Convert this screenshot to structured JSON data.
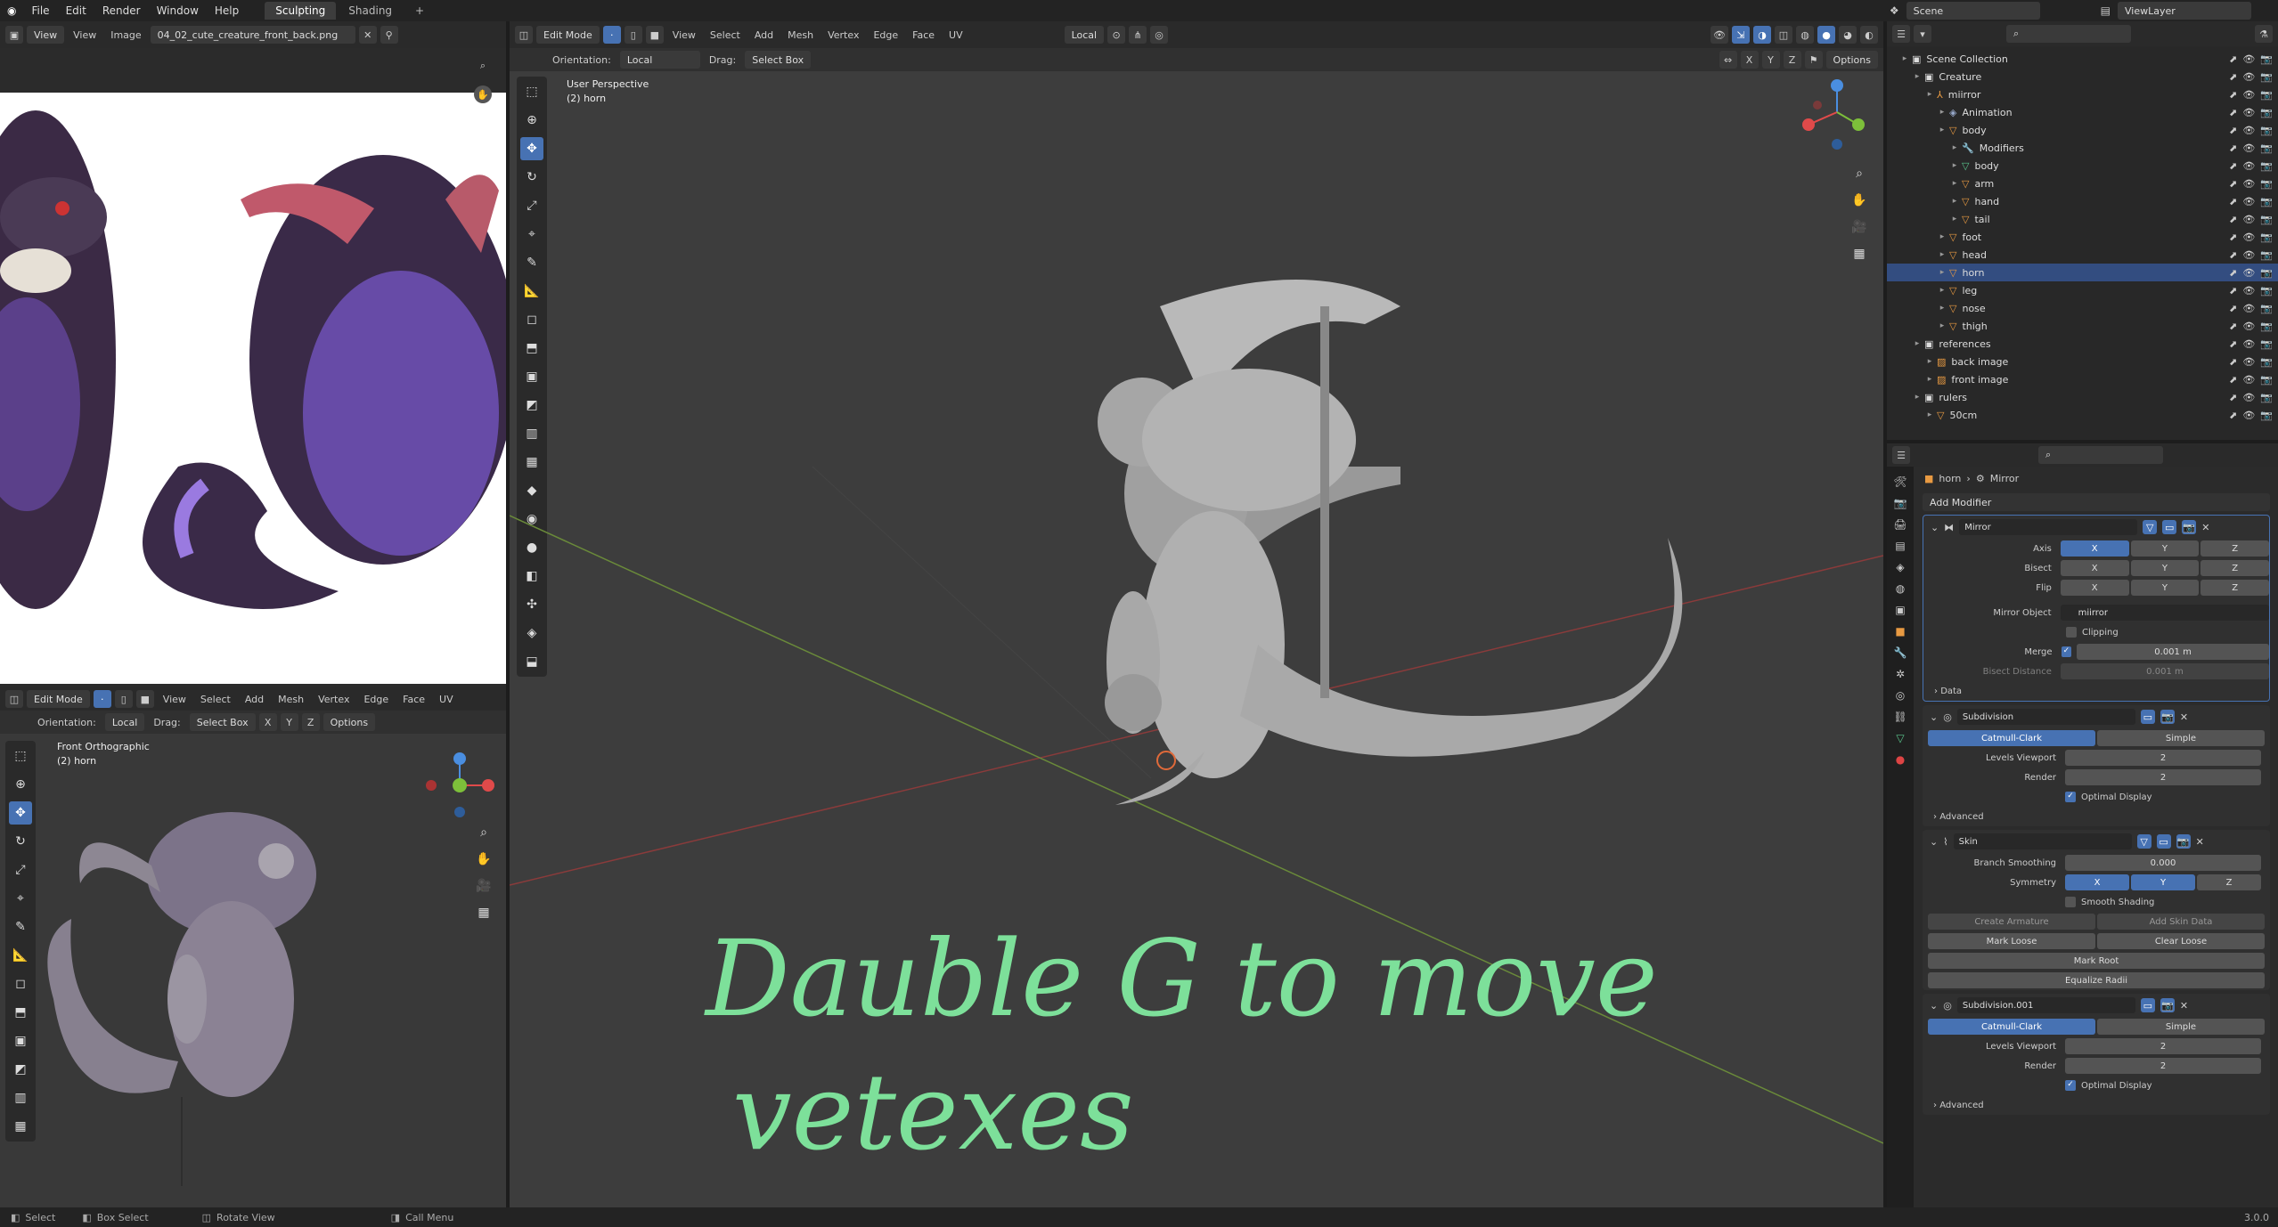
{
  "topbar": {
    "menus": [
      "File",
      "Edit",
      "Render",
      "Window",
      "Help"
    ],
    "workspaces": [
      "Sculpting",
      "Shading",
      "+"
    ],
    "scene": "Scene",
    "view_layer": "ViewLayer"
  },
  "image_editor": {
    "view": "View",
    "image_menu": "View",
    "image_label": "Image",
    "filename": "04_02_cute_creature_front_back.png"
  },
  "viewport_small": {
    "mode": "Edit Mode",
    "menus": [
      "View",
      "Select",
      "Add",
      "Mesh",
      "Vertex",
      "Edge",
      "Face",
      "UV"
    ],
    "orientation_label": "Orientation:",
    "orientation": "Local",
    "drag_label": "Drag:",
    "drag": "Select Box",
    "axes": [
      "X",
      "Y",
      "Z"
    ],
    "options": "Options",
    "view_name": "Front Orthographic",
    "object": "(2) horn"
  },
  "viewport_main": {
    "mode": "Edit Mode",
    "menus": [
      "View",
      "Select",
      "Add",
      "Mesh",
      "Vertex",
      "Edge",
      "Face",
      "UV"
    ],
    "pivot": "Local",
    "orientation_label": "Orientation:",
    "orientation": "Local",
    "drag_label": "Drag:",
    "drag": "Select Box",
    "axes": [
      "X",
      "Y",
      "Z"
    ],
    "options": "Options",
    "view_name": "User Perspective",
    "object": "(2) horn",
    "handwriting_line1": "Dauble G to move",
    "handwriting_line2": "vetexes"
  },
  "outliner": {
    "items": [
      {
        "label": "Scene Collection",
        "indent": 0,
        "icon": "collection"
      },
      {
        "label": "Creature",
        "indent": 1,
        "icon": "collection"
      },
      {
        "label": "miirror",
        "indent": 2,
        "icon": "empty"
      },
      {
        "label": "Animation",
        "indent": 3,
        "icon": "anim"
      },
      {
        "label": "body",
        "indent": 3,
        "icon": "object"
      },
      {
        "label": "Modifiers",
        "indent": 4,
        "icon": "wrench"
      },
      {
        "label": "body",
        "indent": 4,
        "icon": "mesh"
      },
      {
        "label": "arm",
        "indent": 4,
        "icon": "object"
      },
      {
        "label": "hand",
        "indent": 4,
        "icon": "object"
      },
      {
        "label": "tail",
        "indent": 4,
        "icon": "object"
      },
      {
        "label": "foot",
        "indent": 3,
        "icon": "object"
      },
      {
        "label": "head",
        "indent": 3,
        "icon": "object"
      },
      {
        "label": "horn",
        "indent": 3,
        "icon": "object"
      },
      {
        "label": "leg",
        "indent": 3,
        "icon": "object"
      },
      {
        "label": "nose",
        "indent": 3,
        "icon": "object"
      },
      {
        "label": "thigh",
        "indent": 3,
        "icon": "object"
      },
      {
        "label": "references",
        "indent": 1,
        "icon": "collection"
      },
      {
        "label": "back image",
        "indent": 2,
        "icon": "image"
      },
      {
        "label": "front image",
        "indent": 2,
        "icon": "image"
      },
      {
        "label": "rulers",
        "indent": 1,
        "icon": "collection"
      },
      {
        "label": "50cm",
        "indent": 2,
        "icon": "object"
      }
    ]
  },
  "properties": {
    "breadcrumb_object": "horn",
    "breadcrumb_modifier": "Mirror",
    "add_modifier": "Add Modifier",
    "mirror": {
      "name": "Mirror",
      "axis_label": "Axis",
      "bisect_label": "Bisect",
      "flip_label": "Flip",
      "xyz": [
        "X",
        "Y",
        "Z"
      ],
      "mirror_object_label": "Mirror Object",
      "mirror_object": "miirror",
      "clipping": "Clipping",
      "merge_label": "Merge",
      "merge_value": "0.001 m",
      "bisect_distance_label": "Bisect Distance",
      "bisect_distance_value": "0.001 m",
      "data": "Data"
    },
    "subdivision": {
      "name": "Subdivision",
      "catmull": "Catmull-Clark",
      "simple": "Simple",
      "levels_viewport_label": "Levels Viewport",
      "levels_viewport": "2",
      "render_label": "Render",
      "render": "2",
      "optimal": "Optimal Display",
      "advanced": "Advanced"
    },
    "skin": {
      "name": "Skin",
      "branch_label": "Branch Smoothing",
      "branch_value": "0.000",
      "symmetry_label": "Symmetry",
      "xyz": [
        "X",
        "Y",
        "Z"
      ],
      "smooth_shading": "Smooth Shading",
      "create_armature": "Create Armature",
      "add_skin_data": "Add Skin Data",
      "mark_loose": "Mark Loose",
      "clear_loose": "Clear Loose",
      "mark_root": "Mark Root",
      "equalize_radii": "Equalize Radii"
    },
    "subdivision2": {
      "name": "Subdivision.001",
      "catmull": "Catmull-Clark",
      "simple": "Simple",
      "levels_viewport_label": "Levels Viewport",
      "levels_viewport": "2",
      "render_label": "Render",
      "render": "2",
      "optimal": "Optimal Display",
      "advanced": "Advanced"
    }
  },
  "status": {
    "select": "Select",
    "box_select": "Box Select",
    "rotate": "Rotate View",
    "call_menu": "Call Menu",
    "version": "3.0.0"
  }
}
